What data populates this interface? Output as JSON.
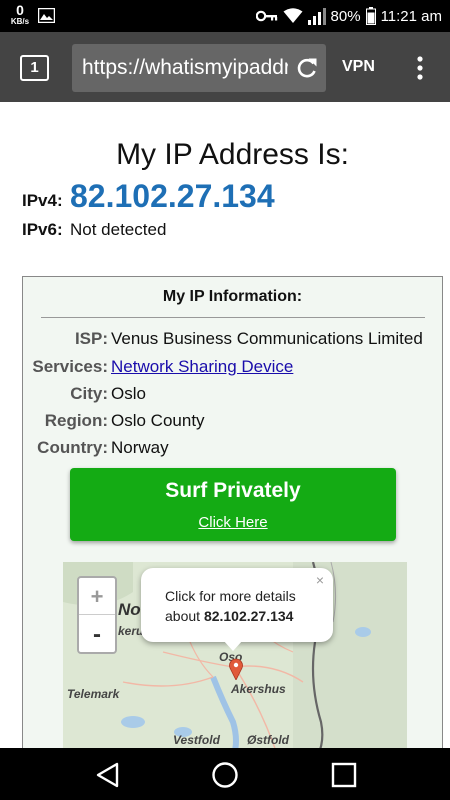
{
  "status_bar": {
    "net_speed_value": "0",
    "net_speed_unit": "KB/s",
    "battery": "80%",
    "time": "11:21 am",
    "icons": [
      "image-icon",
      "key-icon",
      "wifi-icon",
      "signal-icon",
      "battery-icon"
    ]
  },
  "browser": {
    "tab_count": "1",
    "url": "https://whatismyipaddress.com",
    "vpn_label": "VPN",
    "icons": [
      "reload-icon",
      "overflow-menu-icon"
    ]
  },
  "page": {
    "title": "My IP Address Is:",
    "ipv4_label": "IPv4:",
    "ipv4_value": "82.102.27.134",
    "ipv6_label": "IPv6:",
    "ipv6_value": "Not detected"
  },
  "info": {
    "title": "My IP Information:",
    "rows": [
      {
        "key": "ISP:",
        "value": "Venus Business Communications Limited"
      },
      {
        "key": "Services:",
        "value": "Network Sharing Device"
      },
      {
        "key": "City:",
        "value": "Oslo"
      },
      {
        "key": "Region:",
        "value": "Oslo County"
      },
      {
        "key": "Country:",
        "value": "Norway"
      }
    ]
  },
  "surf": {
    "label": "Surf Privately",
    "link": "Click Here"
  },
  "map": {
    "zoom_in": "+",
    "zoom_out": "-",
    "popup_line1": "Click for more details",
    "popup_prefix": "about ",
    "popup_ip": "82.102.27.134",
    "popup_close": "×",
    "labels": {
      "no": "No",
      "kerur": "kerur",
      "oso": "Oso",
      "akershus": "Akershus",
      "telemark": "Telemark",
      "vestfold": "Vestfold",
      "ostfold": "Østfold"
    }
  },
  "colors": {
    "ip_blue": "#1e6fb5",
    "button_green": "#14ab14",
    "toolbar": "#444444",
    "info_bg": "#f2f7f2",
    "marker": "#e05a3a"
  }
}
